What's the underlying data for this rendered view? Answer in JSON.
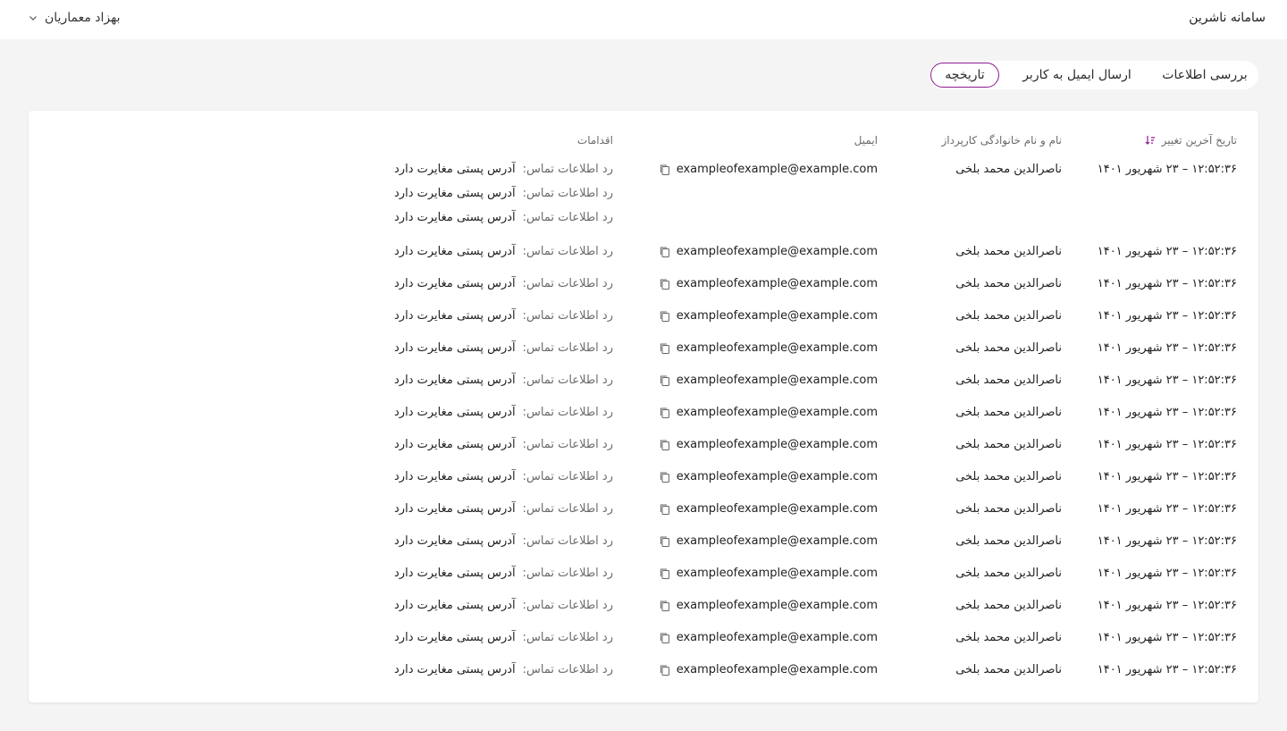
{
  "header": {
    "app_title": "سامانه ناشرین",
    "user_name": "بهزاد معماریان"
  },
  "tabs": [
    {
      "label": "بررسی اطلاعات",
      "active": false
    },
    {
      "label": "ارسال ایمیل به کاربر",
      "active": false
    },
    {
      "label": "تاریخچه",
      "active": true
    }
  ],
  "table": {
    "columns": {
      "date": "تاریخ آخرین تغییر",
      "name": "نام و نام خانوادگی کارپرداز",
      "email": "ایمیل",
      "actions": "اقدامات"
    },
    "rows": [
      {
        "date": "۱۲:۵۲:۳۶ – ۲۳ شهریور ۱۴۰۱",
        "name": "ناصرالدین محمد بلخی",
        "email": "exampleofexample@example.com",
        "actions": [
          {
            "label": "رد اطلاعات تماس:",
            "value": "آدرس پستی مغایرت دارد"
          },
          {
            "label": "رد اطلاعات تماس:",
            "value": "آدرس پستی مغایرت دارد"
          },
          {
            "label": "رد اطلاعات تماس:",
            "value": "آدرس پستی مغایرت دارد"
          }
        ]
      },
      {
        "date": "۱۲:۵۲:۳۶ – ۲۳ شهریور ۱۴۰۱",
        "name": "ناصرالدین محمد بلخی",
        "email": "exampleofexample@example.com",
        "actions": [
          {
            "label": "رد اطلاعات تماس:",
            "value": "آدرس پستی مغایرت دارد"
          }
        ]
      },
      {
        "date": "۱۲:۵۲:۳۶ – ۲۳ شهریور ۱۴۰۱",
        "name": "ناصرالدین محمد بلخی",
        "email": "exampleofexample@example.com",
        "actions": [
          {
            "label": "رد اطلاعات تماس:",
            "value": "آدرس پستی مغایرت دارد"
          }
        ]
      },
      {
        "date": "۱۲:۵۲:۳۶ – ۲۳ شهریور ۱۴۰۱",
        "name": "ناصرالدین محمد بلخی",
        "email": "exampleofexample@example.com",
        "actions": [
          {
            "label": "رد اطلاعات تماس:",
            "value": "آدرس پستی مغایرت دارد"
          }
        ]
      },
      {
        "date": "۱۲:۵۲:۳۶ – ۲۳ شهریور ۱۴۰۱",
        "name": "ناصرالدین محمد بلخی",
        "email": "exampleofexample@example.com",
        "actions": [
          {
            "label": "رد اطلاعات تماس:",
            "value": "آدرس پستی مغایرت دارد"
          }
        ]
      },
      {
        "date": "۱۲:۵۲:۳۶ – ۲۳ شهریور ۱۴۰۱",
        "name": "ناصرالدین محمد بلخی",
        "email": "exampleofexample@example.com",
        "actions": [
          {
            "label": "رد اطلاعات تماس:",
            "value": "آدرس پستی مغایرت دارد"
          }
        ]
      },
      {
        "date": "۱۲:۵۲:۳۶ – ۲۳ شهریور ۱۴۰۱",
        "name": "ناصرالدین محمد بلخی",
        "email": "exampleofexample@example.com",
        "actions": [
          {
            "label": "رد اطلاعات تماس:",
            "value": "آدرس پستی مغایرت دارد"
          }
        ]
      },
      {
        "date": "۱۲:۵۲:۳۶ – ۲۳ شهریور ۱۴۰۱",
        "name": "ناصرالدین محمد بلخی",
        "email": "exampleofexample@example.com",
        "actions": [
          {
            "label": "رد اطلاعات تماس:",
            "value": "آدرس پستی مغایرت دارد"
          }
        ]
      },
      {
        "date": "۱۲:۵۲:۳۶ – ۲۳ شهریور ۱۴۰۱",
        "name": "ناصرالدین محمد بلخی",
        "email": "exampleofexample@example.com",
        "actions": [
          {
            "label": "رد اطلاعات تماس:",
            "value": "آدرس پستی مغایرت دارد"
          }
        ]
      },
      {
        "date": "۱۲:۵۲:۳۶ – ۲۳ شهریور ۱۴۰۱",
        "name": "ناصرالدین محمد بلخی",
        "email": "exampleofexample@example.com",
        "actions": [
          {
            "label": "رد اطلاعات تماس:",
            "value": "آدرس پستی مغایرت دارد"
          }
        ]
      },
      {
        "date": "۱۲:۵۲:۳۶ – ۲۳ شهریور ۱۴۰۱",
        "name": "ناصرالدین محمد بلخی",
        "email": "exampleofexample@example.com",
        "actions": [
          {
            "label": "رد اطلاعات تماس:",
            "value": "آدرس پستی مغایرت دارد"
          }
        ]
      },
      {
        "date": "۱۲:۵۲:۳۶ – ۲۳ شهریور ۱۴۰۱",
        "name": "ناصرالدین محمد بلخی",
        "email": "exampleofexample@example.com",
        "actions": [
          {
            "label": "رد اطلاعات تماس:",
            "value": "آدرس پستی مغایرت دارد"
          }
        ]
      },
      {
        "date": "۱۲:۵۲:۳۶ – ۲۳ شهریور ۱۴۰۱",
        "name": "ناصرالدین محمد بلخی",
        "email": "exampleofexample@example.com",
        "actions": [
          {
            "label": "رد اطلاعات تماس:",
            "value": "آدرس پستی مغایرت دارد"
          }
        ]
      },
      {
        "date": "۱۲:۵۲:۳۶ – ۲۳ شهریور ۱۴۰۱",
        "name": "ناصرالدین محمد بلخی",
        "email": "exampleofexample@example.com",
        "actions": [
          {
            "label": "رد اطلاعات تماس:",
            "value": "آدرس پستی مغایرت دارد"
          }
        ]
      },
      {
        "date": "۱۲:۵۲:۳۶ – ۲۳ شهریور ۱۴۰۱",
        "name": "ناصرالدین محمد بلخی",
        "email": "exampleofexample@example.com",
        "actions": [
          {
            "label": "رد اطلاعات تماس:",
            "value": "آدرس پستی مغایرت دارد"
          }
        ]
      }
    ]
  },
  "icons": {
    "sort": "sort-descending-icon",
    "copy": "copy-icon",
    "chevron": "chevron-down-icon"
  },
  "colors": {
    "accent": "#8b1a8e",
    "page_bg": "#f4f4f5"
  }
}
